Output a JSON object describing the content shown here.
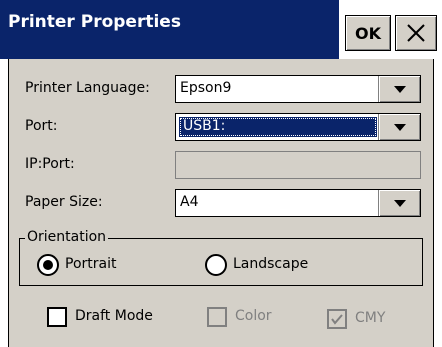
{
  "window": {
    "title": "Printer Properties",
    "ok_label": "OK",
    "close_icon": "close-icon"
  },
  "fields": {
    "printer_language": {
      "label": "Printer Language:",
      "value": "Epson9"
    },
    "port": {
      "label": "Port:",
      "value": "USB1:"
    },
    "ip_port": {
      "label": "IP:Port:",
      "value": ""
    },
    "paper_size": {
      "label": "Paper Size:",
      "value": "A4"
    }
  },
  "orientation": {
    "legend": "Orientation",
    "portrait_label": "Portrait",
    "landscape_label": "Landscape",
    "selected": "Portrait"
  },
  "options": {
    "draft_mode": {
      "label": "Draft Mode",
      "checked": false,
      "enabled": true
    },
    "color": {
      "label": "Color",
      "checked": false,
      "enabled": false
    },
    "cmy": {
      "label": "CMY",
      "checked": true,
      "enabled": false
    }
  },
  "colors": {
    "title_bar": "#0a246a",
    "face": "#d4d0c8",
    "disabled_text": "#808080"
  }
}
